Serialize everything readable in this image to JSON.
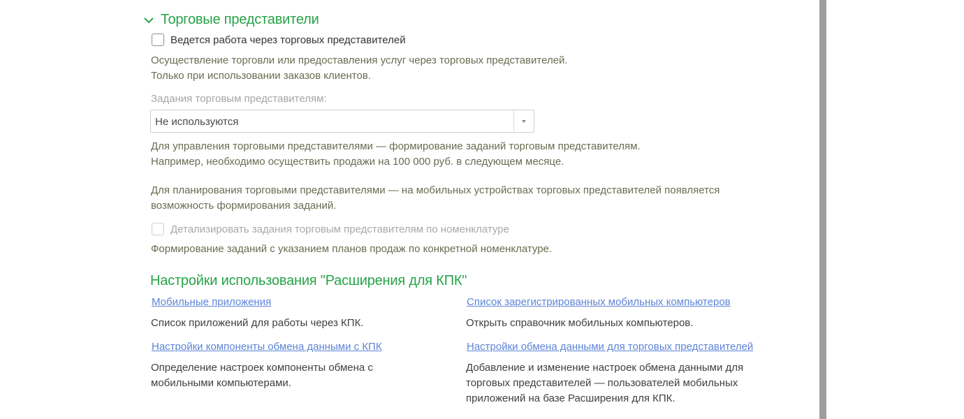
{
  "section": {
    "title": "Торговые представители"
  },
  "trade_reps": {
    "checkbox_label": "Ведется работа через торговых представителей",
    "desc_line1": "Осуществление торговли или предоставления услуг через торговых представителей.",
    "desc_line2": "Только при использовании заказов клиентов."
  },
  "tasks": {
    "label": "Задания торговым представителям:",
    "selected_value": "Не используются",
    "desc1_line1": "Для управления торговыми представителями — формирование заданий торговым представителям.",
    "desc1_line2": "Например, необходимо осуществить продажи на 100 000 руб. в следующем месяце.",
    "desc2_line1": "Для планирования торговыми представителями — на мобильных устройствах торговых представителей появляется",
    "desc2_line2": "возможность формирования заданий."
  },
  "detail": {
    "checkbox_label": "Детализировать задания торговым представителям по номенклатуре",
    "desc": "Формирование заданий с указанием планов продаж по конкретной номенклатуре."
  },
  "kpk": {
    "title": "Настройки использования \"Расширения для КПК\"",
    "items": [
      {
        "link": "Мобильные приложения",
        "desc_lines": [
          "Список приложений для работы через КПК."
        ]
      },
      {
        "link": "Список зарегистрированных мобильных компьютеров",
        "desc_lines": [
          "Открыть справочник мобильных компьютеров."
        ]
      },
      {
        "link": "Настройки компоненты обмена данными с КПК",
        "desc_lines": [
          "Определение настроек компоненты обмена с",
          "мобильными компьютерами."
        ]
      },
      {
        "link": "Настройки обмена данными для торговых представителей",
        "desc_lines": [
          "Добавление и изменение настроек обмена данными для",
          "торговых представителей — пользователей мобильных",
          "приложений на базе Расширения для КПК."
        ]
      }
    ]
  },
  "colors": {
    "accent_green": "#27a348",
    "link_blue": "#5d84d6",
    "scrollbar": "#9e9e9e"
  }
}
